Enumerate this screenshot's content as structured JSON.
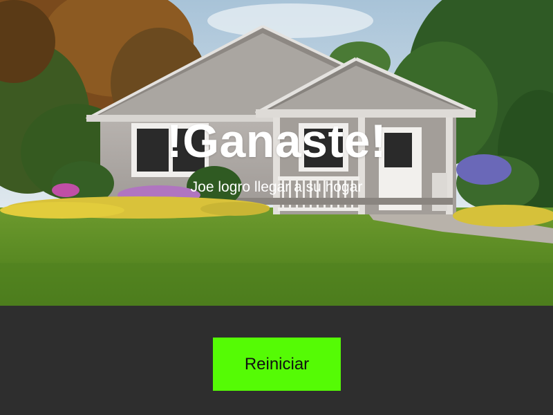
{
  "screen": {
    "title": "!Ganaste!",
    "message": "Joe logro llegar a su hogar",
    "restart_label": "Reiniciar"
  },
  "colors": {
    "background": "#2e2e2e",
    "button": "#55fb05",
    "title_text": "#ffffff"
  }
}
